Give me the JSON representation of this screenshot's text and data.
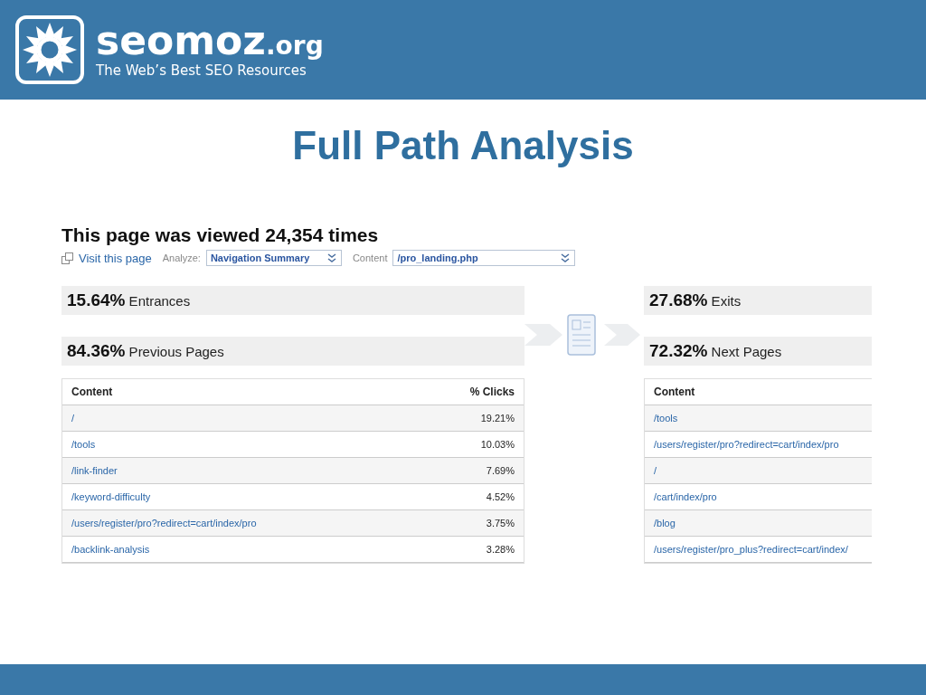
{
  "header": {
    "logo_name": "seomoz",
    "logo_suffix": ".org",
    "tagline": "The Web’s Best SEO Resources"
  },
  "slide_title": "Full Path Analysis",
  "report": {
    "heading": "This page was viewed 24,354 times",
    "visit_link": "Visit this page",
    "analyze": {
      "label": "Analyze:",
      "value": "Navigation Summary"
    },
    "content": {
      "label": "Content",
      "value": "/pro_landing.php"
    },
    "left_stats": [
      {
        "percent": "15.64%",
        "label": "Entrances"
      },
      {
        "percent": "84.36%",
        "label": "Previous Pages"
      }
    ],
    "right_stats": [
      {
        "percent": "27.68%",
        "label": "Exits"
      },
      {
        "percent": "72.32%",
        "label": "Next Pages"
      }
    ],
    "previous_table": {
      "columns": [
        "Content",
        "% Clicks"
      ],
      "rows": [
        [
          "/",
          "19.21%"
        ],
        [
          "/tools",
          "10.03%"
        ],
        [
          "/link-finder",
          "7.69%"
        ],
        [
          "/keyword-difficulty",
          "4.52%"
        ],
        [
          "/users/register/pro?redirect=cart/index/pro",
          "3.75%"
        ],
        [
          "/backlink-analysis",
          "3.28%"
        ]
      ]
    },
    "next_table": {
      "columns": [
        "Content"
      ],
      "rows": [
        [
          "/tools"
        ],
        [
          "/users/register/pro?redirect=cart/index/pro"
        ],
        [
          "/"
        ],
        [
          "/cart/index/pro"
        ],
        [
          "/blog"
        ],
        [
          "/users/register/pro_plus?redirect=cart/index/"
        ]
      ]
    }
  }
}
